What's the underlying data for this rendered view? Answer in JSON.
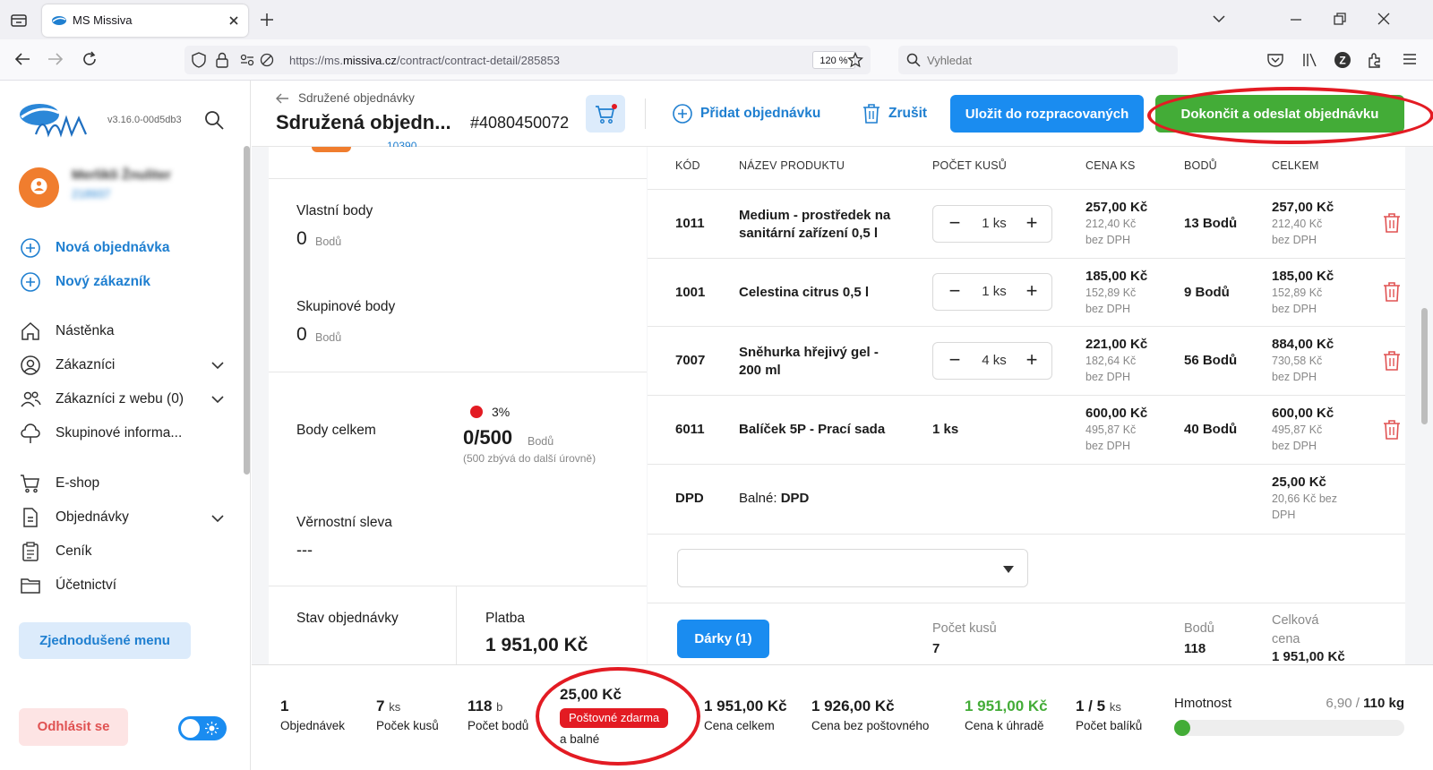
{
  "browser": {
    "tab_title": "MS Missiva",
    "url_prefix": "https://ms.",
    "url_domain": "missiva.cz",
    "url_path": "/contract/contract-detail/285853",
    "zoom": "120 %",
    "search_placeholder": "Vyhledat"
  },
  "sidebar": {
    "version": "v3.16.0-00d5db3",
    "user_name": "Merlikli Žnuliter",
    "user_id": "218937",
    "quick": [
      {
        "label": "Nová objednávka"
      },
      {
        "label": "Nový zákazník"
      }
    ],
    "items": [
      {
        "label": "Nástěnka",
        "icon": "home-icon"
      },
      {
        "label": "Zákazníci",
        "icon": "user-circle-icon",
        "expandable": true
      },
      {
        "label": "Zákazníci z webu (0)",
        "icon": "users-icon",
        "expandable": true
      },
      {
        "label": "Skupinové informa...",
        "icon": "cloud-icon"
      },
      {
        "label": "E-shop",
        "icon": "cart-icon"
      },
      {
        "label": "Objednávky",
        "icon": "document-icon",
        "expandable": true
      },
      {
        "label": "Ceník",
        "icon": "clipboard-icon"
      },
      {
        "label": "Účetnictví",
        "icon": "folder-icon"
      }
    ],
    "simplified_menu": "Zjednodušené menu",
    "logout": "Odhlásit se"
  },
  "header": {
    "breadcrumb": "Sdružené objednávky",
    "title": "Sdružená objedn...",
    "order_number": "#4080450072",
    "add_order": "Přidat objednávku",
    "cancel": "Zrušit",
    "save": "Uložit do rozpracovaných",
    "finish": "Dokončit a odeslat objednávku"
  },
  "left": {
    "top_partial": "10390",
    "own_points_label": "Vlastní body",
    "own_points_value": "0",
    "group_points_label": "Skupinové body",
    "group_points_value": "0",
    "points_unit": "Bodů",
    "total_points_label": "Body celkem",
    "total_percent": "3%",
    "total_points_value": "0/500",
    "total_points_note": "(500 zbývá do další úrovně)",
    "loyalty_label": "Věrnostní sleva",
    "loyalty_value": "---",
    "status_label": "Stav objednávky",
    "payment_label": "Platba",
    "payment_value": "1 951,00 Kč"
  },
  "table": {
    "headers": [
      "KÓD",
      "NÁZEV PRODUKTU",
      "POČET KUSŮ",
      "CENA KS",
      "BODŮ",
      "CELKEM"
    ],
    "rows": [
      {
        "code": "1011",
        "name1": "Medium - prostředek na",
        "name2": "sanitární zařízení 0,5 l",
        "qty": "1 ks",
        "price": "257,00 Kč",
        "price_net": "212,40 Kč",
        "bez": "bez DPH",
        "points": "13 Bodů",
        "total": "257,00 Kč",
        "total_net": "212,40 Kč"
      },
      {
        "code": "1001",
        "name1": "Celestina citrus 0,5 l",
        "name2": "",
        "qty": "1 ks",
        "price": "185,00 Kč",
        "price_net": "152,89 Kč",
        "bez": "bez DPH",
        "points": "9 Bodů",
        "total": "185,00 Kč",
        "total_net": "152,89 Kč"
      },
      {
        "code": "7007",
        "name1": "Sněhurka hřejivý gel -",
        "name2": "200 ml",
        "qty": "4 ks",
        "price": "221,00 Kč",
        "price_net": "182,64 Kč",
        "bez": "bez DPH",
        "points": "56 Bodů",
        "total": "884,00 Kč",
        "total_net": "730,58 Kč"
      },
      {
        "code": "6011",
        "name1": "Balíček 5P - Prací sada",
        "name2": "",
        "qty": "1 ks",
        "price": "600,00 Kč",
        "price_net": "495,87 Kč",
        "bez": "bez DPH",
        "points": "40 Bodů",
        "total": "600,00 Kč",
        "total_net": "495,87 Kč"
      }
    ],
    "dpd": {
      "code": "DPD",
      "label": "Balné:",
      "value": "DPD",
      "total": "25,00 Kč",
      "net1": "20,66 Kč bez",
      "net2": "DPH"
    },
    "gifts_button": "Dárky (1)",
    "sum_qty_label": "Počet kusů",
    "sum_qty": "7",
    "sum_points_label": "Bodů",
    "sum_points": "118",
    "sum_total_label1": "Celková",
    "sum_total_label2": "cena",
    "sum_total": "1 951,00 Kč"
  },
  "footer": {
    "orders": "1",
    "orders_label": "Objednávek",
    "pieces": "7",
    "pieces_unit": "ks",
    "pieces_label": "Poček kusů",
    "points": "118",
    "points_unit": "b",
    "points_label": "Počet bodů",
    "shipping": "25,00 Kč",
    "free_shipping": "Poštovné zdarma",
    "shipping_label": "a balné",
    "total": "1 951,00 Kč",
    "total_label": "Cena celkem",
    "no_shipping": "1 926,00 Kč",
    "no_shipping_label": "Cena bez poštovného",
    "to_pay": "1 951,00 Kč",
    "to_pay_label": "Cena k úhradě",
    "packages": "1 / 5",
    "packages_unit": "ks",
    "packages_label": "Počet balíků",
    "weight_label": "Hmotnost",
    "weight_value": "6,90 /",
    "weight_max": "110 kg",
    "weight_fraction": 0.063
  },
  "colors": {
    "primary": "#1a8cf0",
    "green": "#43ac37",
    "red": "#e31b23",
    "avatar": "#f07d2e"
  }
}
